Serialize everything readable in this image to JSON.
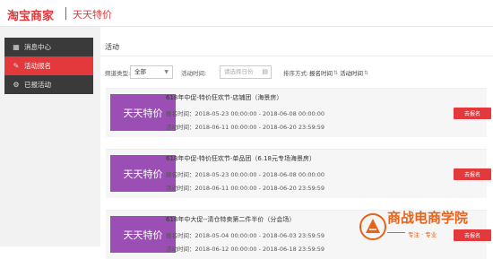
{
  "header": {
    "logo": "淘宝商家",
    "subtitle": "天天特价"
  },
  "sidebar": {
    "items": [
      {
        "label": "消息中心",
        "icon": "grid-icon",
        "active": false
      },
      {
        "label": "活动报名",
        "icon": "edit-icon",
        "active": true
      },
      {
        "label": "已报活动",
        "icon": "settings-icon",
        "active": false
      }
    ]
  },
  "main": {
    "title": "活动",
    "filters": {
      "type_label": "频道类型:",
      "type_value": "全部",
      "time_label": "活动时间:",
      "time_placeholder": "请选择日份",
      "sort_label": "排序方式:",
      "sort_options": [
        "报名时间",
        "活动时间"
      ]
    },
    "cards": [
      {
        "thumb": "天天特价",
        "title": "618年中促-特价狂欢节-店铺团（海景房）",
        "signup_time": "报名时间：2018-05-23 00:00:00 - 2018-06-08 00:00:00",
        "activity_time": "活动时间：2018-06-11 00:00:00 - 2018-06-20 23:59:59",
        "button": "去报名"
      },
      {
        "thumb": "天天特价",
        "title": "618年中促-特价狂欢节-单品团（6.18元专场海景房）",
        "signup_time": "报名时间：2018-05-23 00:00:00 - 2018-06-08 00:00:00",
        "activity_time": "活动时间：2018-06-11 00:00:00 - 2018-06-20 23:59:59",
        "button": "去报名"
      },
      {
        "thumb": "天天特价",
        "title": "618年中大促--清仓特卖第二件半价（分会场）",
        "signup_time": "报名时间：2018-05-04 00:00:00 - 2018-06-03 23:59:59",
        "activity_time": "活动时间：2018-06-12 00:00:00 - 2018-06-18 23:59:59",
        "button": "去报名"
      }
    ]
  },
  "watermark": {
    "title": "商战电商学院",
    "slogan": "专注 · 专业"
  },
  "colors": {
    "accent": "#e4393c",
    "thumb": "#9b4fb4",
    "sidebar": "#3a3a3a",
    "watermark": "#e8621a"
  }
}
